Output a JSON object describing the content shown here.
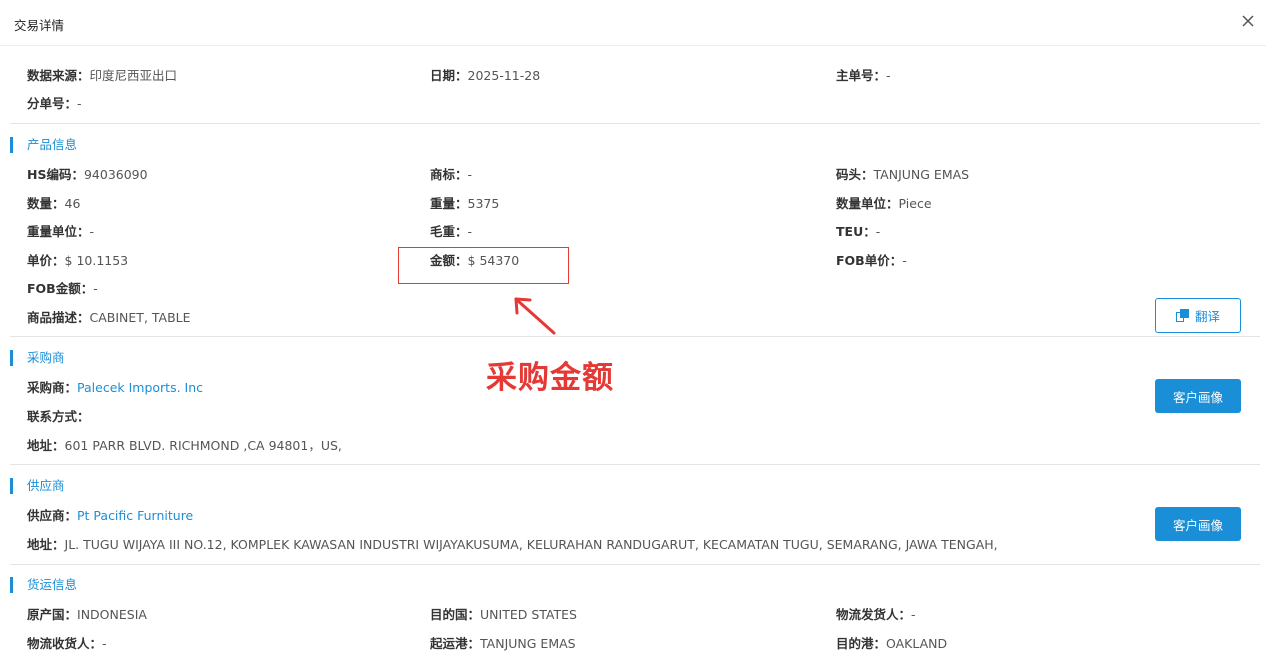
{
  "dialog": {
    "title": "交易详情"
  },
  "basic": {
    "source_label": "数据来源：",
    "source_value": "印度尼西亚出口",
    "date_label": "日期：",
    "date_value": "2025-11-28",
    "master_label": "主单号：",
    "master_value": "-",
    "house_label": "分单号：",
    "house_value": "-"
  },
  "product": {
    "title": "产品信息",
    "hs_label": "HS编码：",
    "hs_value": "94036090",
    "brand_label": "商标：",
    "brand_value": "-",
    "terminal_label": "码头：",
    "terminal_value": "TANJUNG EMAS",
    "qty_label": "数量：",
    "qty_value": "46",
    "weight_label": "重量：",
    "weight_value": "5375",
    "qty_unit_label": "数量单位：",
    "qty_unit_value": "Piece",
    "weight_unit_label": "重量单位：",
    "weight_unit_value": "-",
    "gross_label": "毛重：",
    "gross_value": "-",
    "teu_label": "TEU：",
    "teu_value": "-",
    "price_label": "单价：",
    "price_value": "$ 10.1153",
    "amount_label": "金额：",
    "amount_value": "$ 54370",
    "fob_price_label": "FOB单价：",
    "fob_price_value": "-",
    "fob_amount_label": "FOB金额：",
    "fob_amount_value": "-",
    "desc_label": "商品描述：",
    "desc_value": "CABINET, TABLE",
    "translate_label": "翻译"
  },
  "buyer": {
    "title": "采购商",
    "name_label": "采购商：",
    "name_value": "Palecek Imports. Inc",
    "contact_label": "联系方式：",
    "address_label": "地址：",
    "address_value": "601 PARR BLVD. RICHMOND ,CA 94801，US,",
    "profile_label": "客户画像"
  },
  "supplier": {
    "title": "供应商",
    "name_label": "供应商：",
    "name_value": "Pt Pacific Furniture",
    "address_label": "地址：",
    "address_value": "JL. TUGU WIJAYA III NO.12, KOMPLEK KAWASAN INDUSTRI WIJAYAKUSUMA, KELURAHAN RANDUGARUT, KECAMATAN TUGU, SEMARANG, JAWA TENGAH,",
    "profile_label": "客户画像"
  },
  "shipping": {
    "title": "货运信息",
    "origin_label": "原产国：",
    "origin_value": "INDONESIA",
    "dest_label": "目的国：",
    "dest_value": "UNITED STATES",
    "shipper_label": "物流发货人：",
    "shipper_value": "-",
    "consignee_label": "物流收货人：",
    "consignee_value": "-",
    "load_port_label": "起运港：",
    "load_port_value": "TANJUNG EMAS",
    "dest_port_label": "目的港：",
    "dest_port_value": "OAKLAND"
  },
  "annotation": {
    "text": "采购金额",
    "color": "#e53935"
  },
  "colors": {
    "accent": "#1a8fd8",
    "annotation": "#e53935"
  }
}
